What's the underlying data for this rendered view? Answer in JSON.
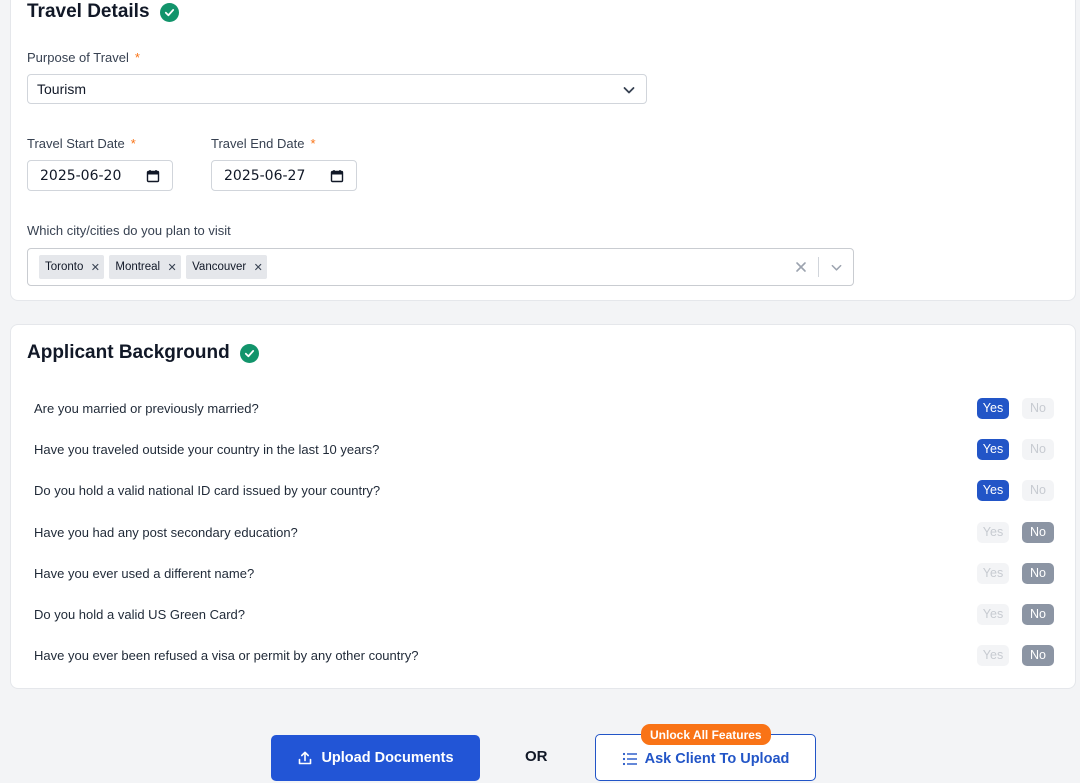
{
  "travel": {
    "title": "Travel Details",
    "purpose": {
      "label": "Purpose of Travel",
      "required_mark": "*",
      "value": "Tourism"
    },
    "start_date": {
      "label": "Travel Start Date",
      "required_mark": "*",
      "value": "2025-06-20"
    },
    "end_date": {
      "label": "Travel End Date",
      "required_mark": "*",
      "value": "2025-06-27"
    },
    "cities": {
      "label": "Which city/cities do you plan to visit",
      "selected": [
        "Toronto",
        "Montreal",
        "Vancouver"
      ]
    }
  },
  "background": {
    "title": "Applicant Background",
    "yes_label": "Yes",
    "no_label": "No",
    "questions": [
      {
        "text": "Are you married or previously married?",
        "answer": "Yes"
      },
      {
        "text": "Have you traveled outside your country in the last 10 years?",
        "answer": "Yes"
      },
      {
        "text": "Do you hold a valid national ID card issued by your country?",
        "answer": "Yes"
      },
      {
        "text": "Have you had any post secondary education?",
        "answer": "No"
      },
      {
        "text": "Have you ever used a different name?",
        "answer": "No"
      },
      {
        "text": "Do you hold a valid US Green Card?",
        "answer": "No"
      },
      {
        "text": "Have you ever been refused a visa or permit by any other country?",
        "answer": "No"
      }
    ]
  },
  "actions": {
    "upload_label": "Upload Documents",
    "or_label": "OR",
    "ask_label": "Ask Client To Upload",
    "unlock_badge": "Unlock All Features"
  },
  "colors": {
    "primary": "#2255c7",
    "success": "#12946b",
    "required": "#f97316",
    "no_selected": "#8c95a4"
  }
}
